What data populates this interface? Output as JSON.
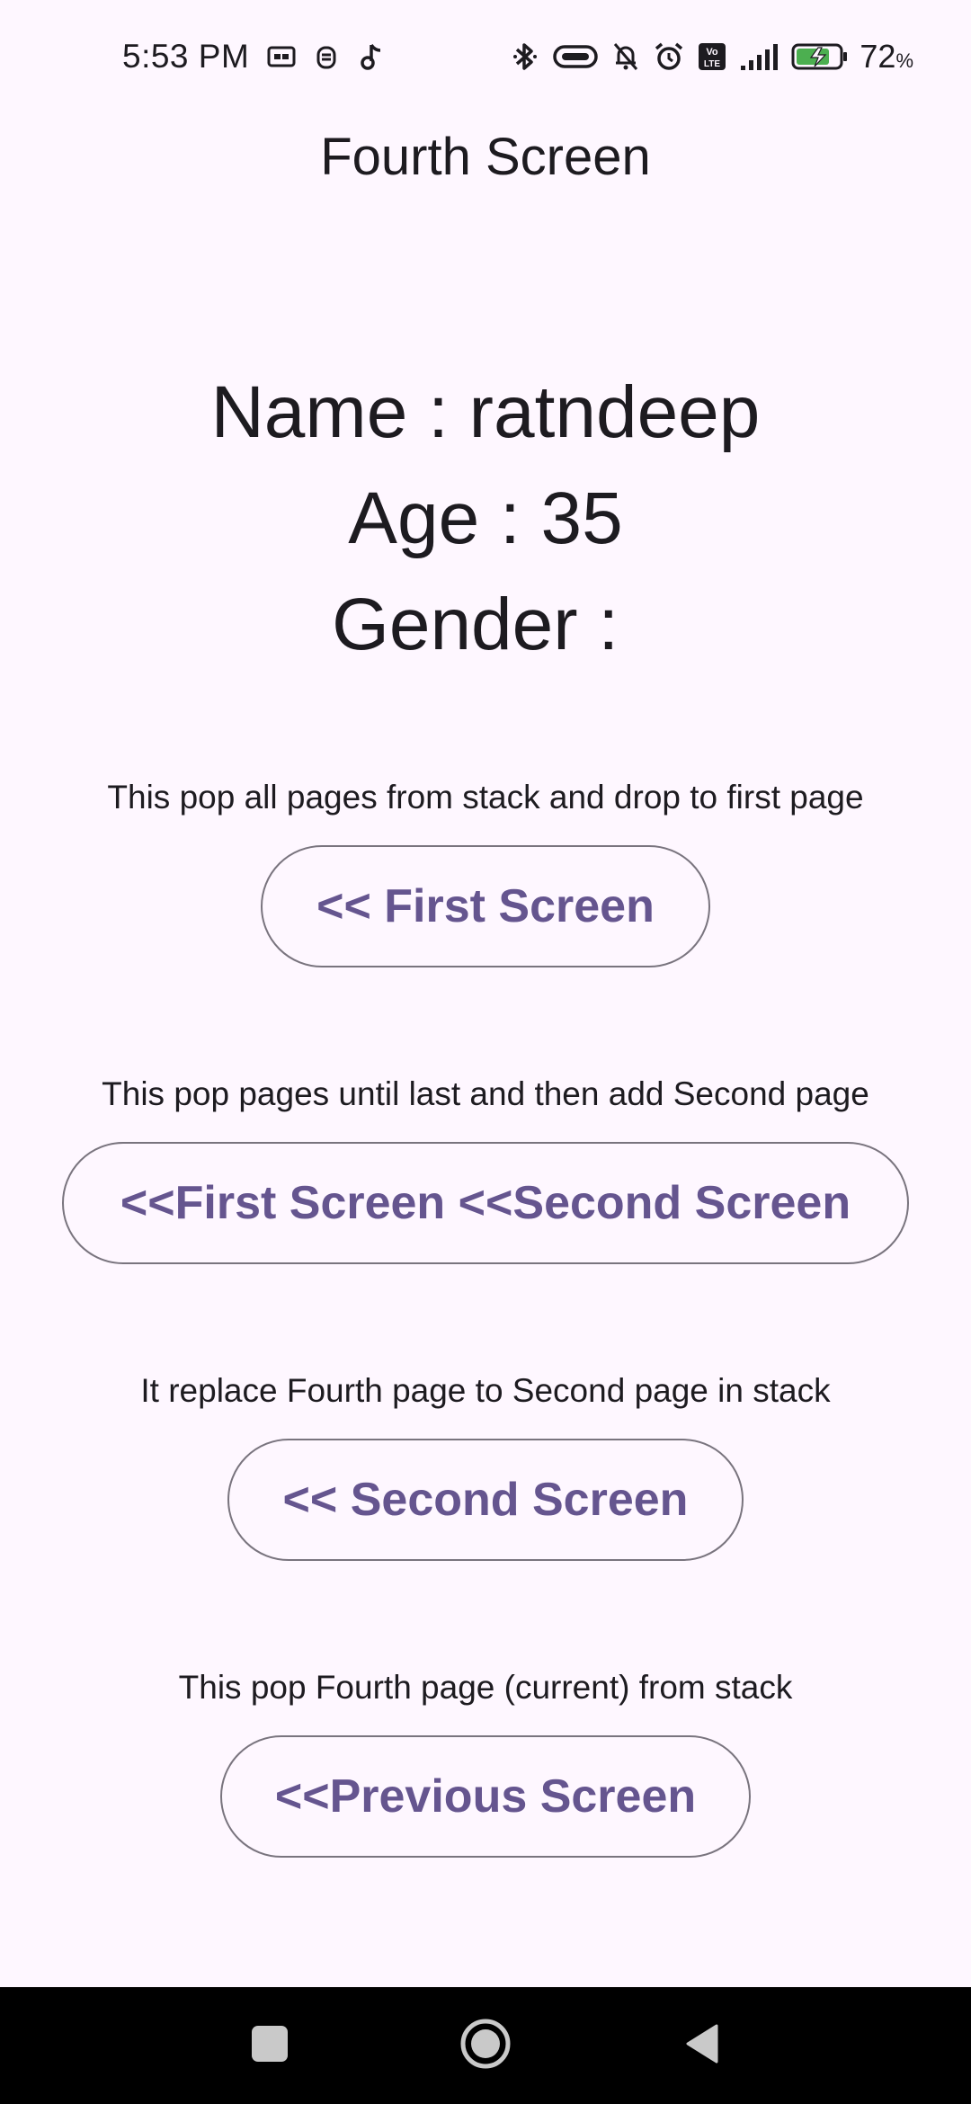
{
  "status_bar": {
    "time": "5:53 PM",
    "left_icons": [
      "card-icon",
      "robot-icon",
      "music-note-icon"
    ],
    "right_icons": [
      "bluetooth-icon",
      "link-icon",
      "bell-off-icon",
      "alarm-icon",
      "volte-icon",
      "signal-icon",
      "battery-charging-icon"
    ],
    "battery_percent": "72",
    "battery_unit": "%"
  },
  "app_bar": {
    "title": "Fourth Screen"
  },
  "info": {
    "name_line": "Name : ratndeep",
    "age_line": "Age : 35",
    "gender_line": "Gender : "
  },
  "actions": [
    {
      "description": "This pop all pages from stack and drop to first page",
      "button_label": "<< First Screen"
    },
    {
      "description": "This pop pages until last and then add Second page",
      "button_label": "<<First Screen <<Second Screen"
    },
    {
      "description": "It replace Fourth page to Second page in stack",
      "button_label": "<< Second Screen"
    },
    {
      "description": "This pop Fourth page (current) from stack",
      "button_label": "<<Previous Screen"
    }
  ],
  "colors": {
    "background": "#fef7ff",
    "button_text": "#65558f",
    "button_border": "#79747e",
    "text": "#1d1b20",
    "nav_bar": "#000000"
  },
  "nav_bar": {
    "buttons": [
      "recents-square-icon",
      "home-circle-icon",
      "back-triangle-icon"
    ]
  }
}
